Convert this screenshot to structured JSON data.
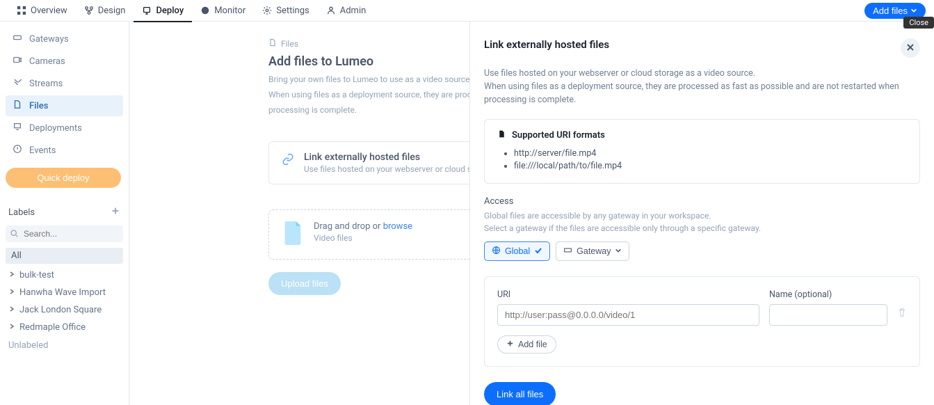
{
  "topnav": {
    "items": [
      {
        "label": "Overview"
      },
      {
        "label": "Design"
      },
      {
        "label": "Deploy"
      },
      {
        "label": "Monitor"
      },
      {
        "label": "Settings"
      },
      {
        "label": "Admin"
      }
    ],
    "add_files_label": "Add files",
    "close_tooltip": "Close"
  },
  "sidebar": {
    "items": [
      {
        "label": "Gateways"
      },
      {
        "label": "Cameras"
      },
      {
        "label": "Streams"
      },
      {
        "label": "Files"
      },
      {
        "label": "Deployments"
      },
      {
        "label": "Events"
      }
    ],
    "quick_deploy": "Quick deploy",
    "labels_title": "Labels",
    "search_placeholder": "Search...",
    "all_label": "All",
    "label_items": [
      "bulk-test",
      "Hanwha Wave Import",
      "Jack London Square",
      "Redmaple Office"
    ],
    "unlabeled": "Unlabeled"
  },
  "main": {
    "breadcrumb": "Files",
    "title": "Add files to Lumeo",
    "sub1": "Bring your own files to Lumeo to use as a video source in",
    "sub2": "When using files as a deployment source, they are proces",
    "sub3": "processing is complete.",
    "card_title": "Link externally hosted files",
    "card_sub": "Use files hosted on your webserver or cloud storag",
    "drop_prefix": "Drag and drop or ",
    "drop_link": "browse",
    "drop_sub": "Video files",
    "upload_label": "Upload files"
  },
  "drawer": {
    "title": "Link externally hosted files",
    "desc_line1": "Use files hosted on your webserver or cloud storage as a video source.",
    "desc_line2": "When using files as a deployment source, they are processed as fast as possible and are not restarted when processing is complete.",
    "formats_title": "Supported URI formats",
    "formats": [
      "http://server/file.mp4",
      "file:///local/path/to/file.mp4"
    ],
    "access_title": "Access",
    "access_desc1": "Global files are accessible by any gateway in your workspace.",
    "access_desc2": "Select a gateway if the files are accessible only through a specific gateway.",
    "pill_global": "Global",
    "pill_gateway": "Gateway",
    "uri_label": "URI",
    "name_label": "Name (optional)",
    "uri_placeholder": "http://user:pass@0.0.0.0/video/1",
    "add_file_label": "Add file",
    "link_all_label": "Link all files"
  }
}
